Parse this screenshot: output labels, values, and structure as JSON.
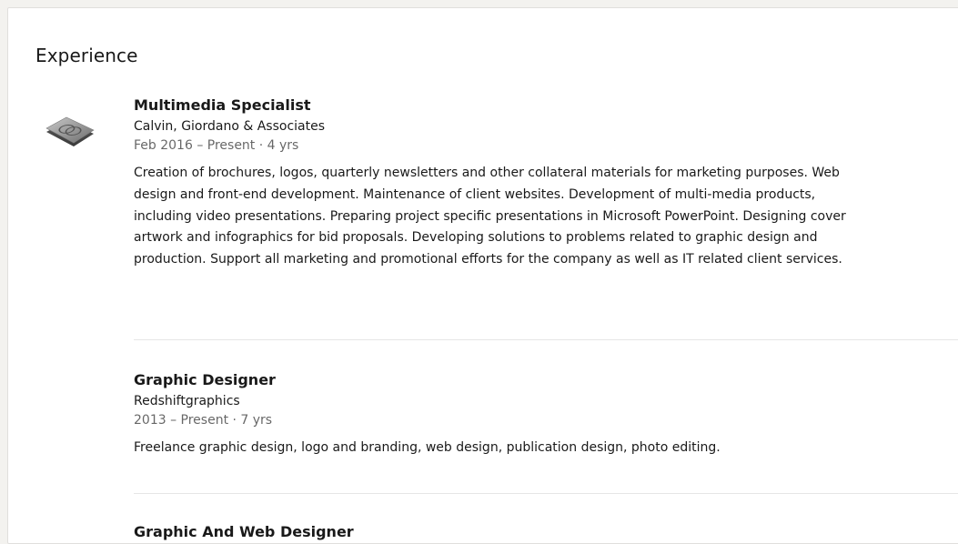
{
  "section": {
    "title": "Experience"
  },
  "experiences": [
    {
      "logo_icon": "company-logo-icon",
      "title": "Multimedia Specialist",
      "company": "Calvin, Giordano & Associates",
      "dates": "Feb 2016 – Present · 4 yrs",
      "description": "Creation of brochures, logos, quarterly newsletters and other collateral materials for marketing purposes. Web design and front-end development. Maintenance of client websites. Development of multi-media products, including video presentations. Preparing project specific presentations in Microsoft PowerPoint. Designing cover artwork and infographics for bid proposals. Developing solutions to problems related to graphic design and production. Support all marketing and promotional efforts for the company as well as IT related client services."
    },
    {
      "title": "Graphic Designer",
      "company": "Redshiftgraphics",
      "dates": "2013 – Present · 7 yrs",
      "description": "Freelance graphic design, logo and branding, web design, publication design, photo editing."
    },
    {
      "title": "Graphic And Web Designer"
    }
  ]
}
